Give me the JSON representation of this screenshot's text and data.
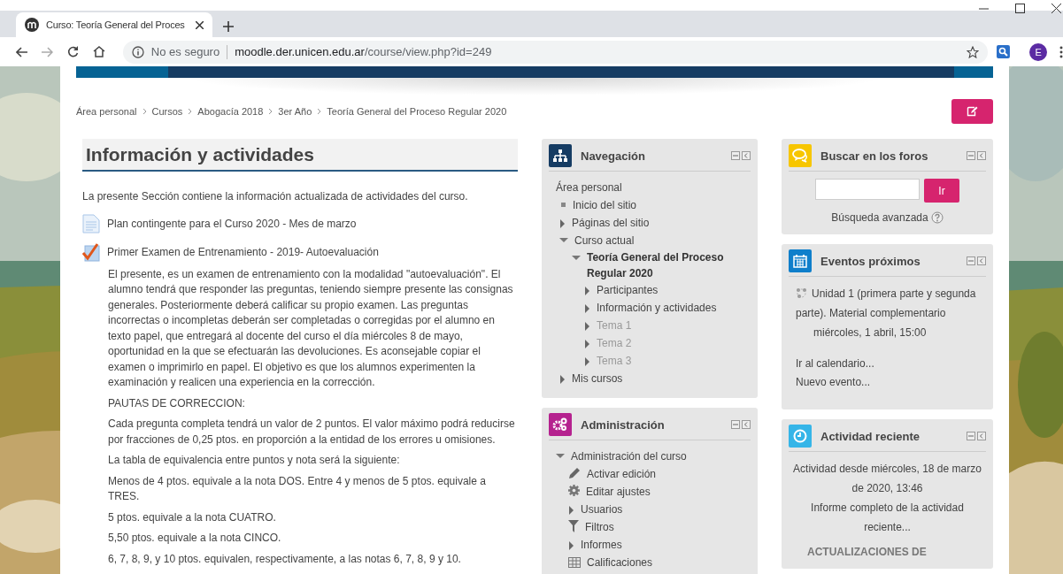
{
  "browser": {
    "tab_title": "Curso: Teoría General del Proces",
    "url_security": "No es seguro",
    "url_host": "moodle.der.unicen.edu.ar",
    "url_path": "/course/view.php?id=249",
    "profile_initial": "E"
  },
  "breadcrumb": [
    "Área personal",
    "Cursos",
    "Abogacía 2018",
    "3er Año",
    "Teoría General del Proceso Regular 2020"
  ],
  "section": {
    "title": "Información y actividades",
    "intro": "La presente Sección contiene la información actualizada de actividades del curso.",
    "activities": [
      {
        "kind": "page",
        "title": "Plan contingente para el Curso 2020 - Mes de marzo"
      },
      {
        "kind": "quiz",
        "title": "Primer Examen de Entrenamiento - 2019- Autoevaluación"
      }
    ],
    "description": [
      "El presente, es un examen de entrenamiento con la modalidad \"autoevaluación\". El alumno tendrá que responder las preguntas, teniendo siempre presente las consignas generales. Posteriormente deberá calificar su propio examen. Las preguntas incorrectas o incompletas deberán ser completadas o corregidas por el alumno en texto papel, que entregará al docente del curso el día miércoles 8 de mayo, oportunidad en la que se efectuarán las devoluciones. Es aconsejable copiar el examen o imprimirlo en papel. El objetivo es que los alumnos experimenten la examinación y realicen una experiencia en la corrección.",
      "PAUTAS DE CORRECCION:",
      "Cada pregunta completa tendrá un valor de 2 puntos. El valor máximo podrá reducirse por fracciones de 0,25 ptos. en proporción a la entidad de los errores u omisiones.",
      "La tabla de equivalencia entre puntos y nota será la siguiente:",
      "Menos de 4 ptos.  equivale a la nota DOS. Entre 4 y menos de 5 ptos. equivale a TRES.",
      "5 ptos. equivale a la nota CUATRO.",
      "5,50 ptos. equivale a la nota CINCO.",
      "6, 7, 8, 9, y 10 ptos. equivalen, respectivamente, a las notas 6, 7, 8, 9 y 10."
    ]
  },
  "navigation": {
    "title": "Navegación",
    "items": [
      {
        "kind": "root",
        "label": "Área personal",
        "children": [
          {
            "kind": "leaf",
            "label": "Inicio del sitio"
          },
          {
            "kind": "branch",
            "label": "Páginas del sitio",
            "expanded": false
          },
          {
            "kind": "branch",
            "label": "Curso actual",
            "expanded": true,
            "children": [
              {
                "kind": "branch",
                "label": "Teoría General del Proceso Regular 2020",
                "expanded": true,
                "current": true,
                "children": [
                  {
                    "kind": "branch",
                    "label": "Participantes",
                    "expanded": false,
                    "dimmed": false
                  },
                  {
                    "kind": "branch",
                    "label": "Información y actividades",
                    "expanded": false,
                    "dimmed": false
                  },
                  {
                    "kind": "branch",
                    "label": "Tema 1",
                    "expanded": false,
                    "dimmed": true
                  },
                  {
                    "kind": "branch",
                    "label": "Tema 2",
                    "expanded": false,
                    "dimmed": true
                  },
                  {
                    "kind": "branch",
                    "label": "Tema 3",
                    "expanded": false,
                    "dimmed": true
                  }
                ]
              }
            ]
          },
          {
            "kind": "branch",
            "label": "Mis cursos",
            "expanded": false
          }
        ]
      }
    ]
  },
  "administration": {
    "title": "Administración",
    "items": [
      {
        "kind": "branch",
        "label": "Administración del curso",
        "expanded": true,
        "children": [
          {
            "kind": "edit",
            "label": "Activar edición"
          },
          {
            "kind": "settings",
            "label": "Editar ajustes"
          },
          {
            "kind": "branch",
            "label": "Usuarios",
            "expanded": false
          },
          {
            "kind": "filter",
            "label": "Filtros"
          },
          {
            "kind": "branch",
            "label": "Informes",
            "expanded": false
          },
          {
            "kind": "grades",
            "label": "Calificaciones"
          }
        ]
      }
    ]
  },
  "forum_search": {
    "title": "Buscar en los foros",
    "button": "Ir",
    "advanced_link": "Búsqueda avanzada"
  },
  "upcoming_events": {
    "title": "Eventos próximos",
    "events": [
      {
        "name": "Unidad 1 (primera parte y segunda parte). Material complementario",
        "date": "miércoles, 1 abril, 15:00"
      }
    ],
    "links": [
      "Ir al calendario...",
      "Nuevo evento..."
    ]
  },
  "recent_activity": {
    "title": "Actividad reciente",
    "since": "Actividad desde miércoles, 18 de marzo de 2020, 13:46",
    "full_report_link": "Informe completo de la actividad reciente...",
    "updates_heading": "ACTUALIZACIONES DE"
  }
}
